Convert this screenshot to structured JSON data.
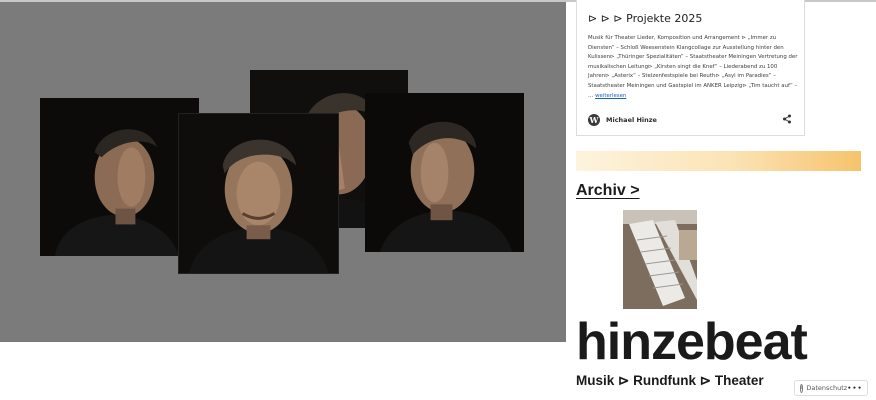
{
  "gallery": {
    "photos": [
      {
        "icon": "portrait-profile-left-photo"
      },
      {
        "icon": "portrait-smiling-photo"
      },
      {
        "icon": "portrait-hand-over-face-photo"
      },
      {
        "icon": "portrait-profile-right-photo"
      }
    ]
  },
  "card": {
    "title": "⊳ ⊳ ⊳ Projekte 2025",
    "text": "Musik für Theater Lieder, Komposition und Arrangement ⊳ „Immer zu Diensten“ – Schloß Weesenstein      Klangcollage zur Ausstellung hinter den Kulissen⊳ „Thüringer Spezialitäten“ – Staatstheater Meiningen Vertretung der musikalischen Leitung⊳ „Kirsten singt die Knef“ – Liederabend zu 100 Jahren⊳ „Asterix“ – Stelzenfestspiele bei Reuth⊳ „Asyl im Paradies“ – Staatstheater Meiningen      und Gastspiel im ANKER Leipzig⊳ „Tim taucht auf“ – …",
    "more": "weiterlesen",
    "author": "Michael Hinze",
    "wp_letter": "W"
  },
  "archive": {
    "label": "Archiv >"
  },
  "site": {
    "title": "hinzebeat",
    "tagline": "Musik ⊳ Rundfunk ⊳ Theater"
  },
  "privacy": {
    "label": "Datenschutz",
    "more": "•••",
    "icon_text": "i"
  },
  "colors": {
    "gallery_bg": "#7b7b7b",
    "link": "#1a5fb4",
    "banner_end": "#f6c36c"
  }
}
